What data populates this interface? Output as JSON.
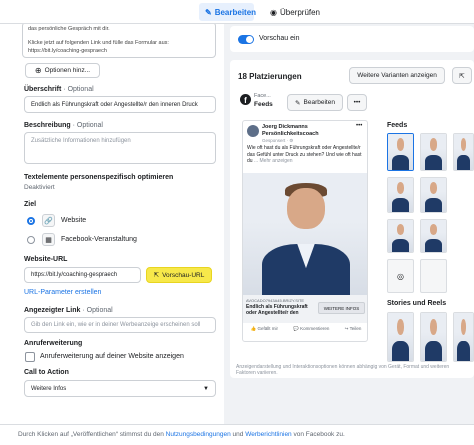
{
  "tabs": {
    "edit": "Bearbeiten",
    "review": "Überprüfen"
  },
  "primary_text": {
    "line1": "das persönliche Gespräch mit dir.",
    "line2": "Klicke jetzt auf folgenden Link und fülle das Formular aus:",
    "line3": "https://bit.ly/coaching-gespraech"
  },
  "options_button": "Optionen hinz...",
  "headline": {
    "label": "Überschrift",
    "optional": " · Optional",
    "value": "Endlich als Führungskraft oder Angestellte/r den inneren Druck"
  },
  "description": {
    "label": "Beschreibung",
    "optional": " · Optional",
    "placeholder": "Zusätzliche Informationen hinzufügen"
  },
  "personalize": {
    "label": "Textelemente personenspezifisch optimieren",
    "status": "Deaktiviert"
  },
  "goal": {
    "label": "Ziel",
    "option1": "Website",
    "option2": "Facebook-Veranstaltung"
  },
  "website_url": {
    "label": "Website-URL",
    "value": "https://bit.ly/coaching-gespraech",
    "preview_button": "Vorschau-URL",
    "params_link": "URL-Parameter erstellen"
  },
  "display_link": {
    "label": "Angezeigter Link",
    "optional": " · Optional",
    "placeholder": "Gib den Link ein, wie er in deiner Werbeanzeige erscheinen soll"
  },
  "call_ext": {
    "label": "Anruferweiterung",
    "checkbox": "Anruferweiterung auf deiner Website anzeigen"
  },
  "cta": {
    "label": "Call to Action",
    "value": "Weitere Infos"
  },
  "preview": {
    "toggle_label": "Vorschau ein",
    "placements": "18 Platzierungen",
    "more_variants": "Weitere Varianten anzeigen",
    "face_label": "Face...",
    "feeds_label": "Feeds",
    "edit_button": "Bearbeiten",
    "ad_name": "Joerg Dickmanns Persönlichkeitscoach",
    "sponsored": "Gesponsert · ⚙",
    "ad_text": "Wie oft hast du als Führungskraft oder Angestellte/r das Gefühl unter Druck zu stehen? Und wie oft hast du",
    "more": "... Mehr anzeigen",
    "link_domain": "AVOCADO7943A45.BRIZY.SITE",
    "link_title": "Endlich als Führungskraft oder Angestellte/r den",
    "cta_button": "WEITERE INFOS",
    "like": "Gefällt mir",
    "comment": "Kommentieren",
    "share": "Teilen",
    "feeds_heading": "Feeds",
    "stories_heading": "Stories und Reels",
    "disclaimer": "Anzeigendarstellung und Interaktionsoptionen können abhängig von Gerät, Format und weiteren Faktoren variieren."
  },
  "footer": {
    "prefix": "Durch Klicken auf „Veröffentlichen“ stimmst du den ",
    "terms": "Nutzungsbedingungen",
    "mid": " und ",
    "policies": "Werberichtlinien",
    "suffix": " von Facebook zu."
  },
  "colors": {
    "accent": "#1b74e4",
    "preview_highlight": "#f7e84a",
    "suit": "#1f3a66"
  }
}
